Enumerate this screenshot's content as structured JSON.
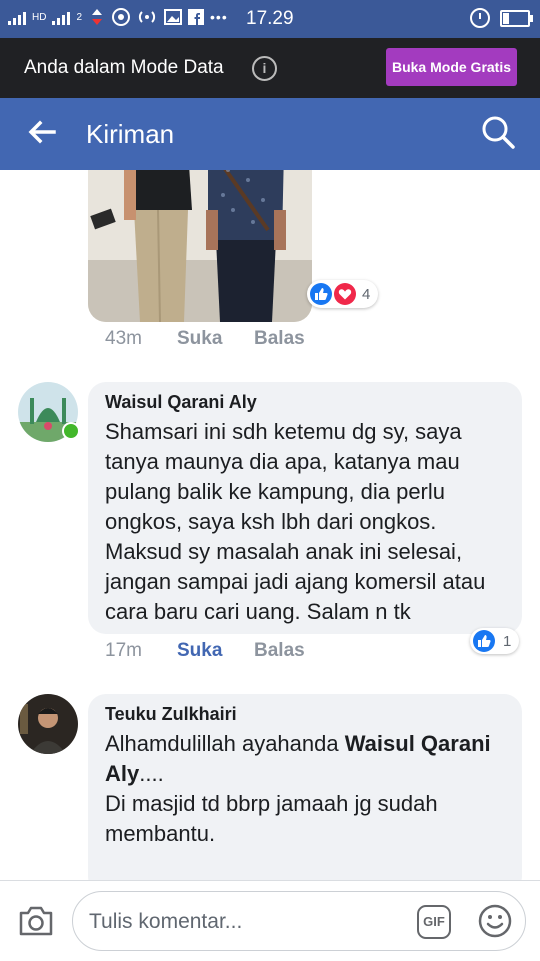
{
  "status_bar": {
    "hd_label": "HD",
    "network_label": "2",
    "time": "17.29",
    "icons": [
      "signal-icon",
      "signal-icon",
      "data-transfer-icon",
      "chrome-icon",
      "hotspot-icon",
      "gallery-icon",
      "facebook-icon",
      "more-icon",
      "alarm-icon",
      "battery-icon"
    ]
  },
  "data_mode": {
    "message": "Anda dalam Mode Data",
    "info_icon": "i",
    "button_label": "Buka Mode Gratis",
    "button_color": "#a33bbf"
  },
  "header": {
    "title": "Kiriman",
    "back_icon": "back-arrow-icon",
    "search_icon": "search-icon",
    "color": "#4267b2"
  },
  "post_photo": {
    "reaction_count": "4",
    "meta": {
      "time": "43m",
      "like": "Suka",
      "reply": "Balas"
    }
  },
  "comments": [
    {
      "author": "Waisul Qarani Aly",
      "text": "Shamsari ini sdh ketemu dg sy, saya tanya maunya dia apa, katanya mau pulang balik ke kampung, dia perlu ongkos, saya ksh lbh dari ongkos. Maksud sy masalah anak ini selesai, jangan sampai jadi ajang  komersil atau cara baru cari uang. Salam n tk",
      "online": true,
      "like_count": "1",
      "meta": {
        "time": "17m",
        "like": "Suka",
        "reply": "Balas",
        "liked": true
      }
    },
    {
      "author": "Teuku Zulkhairi",
      "text_before": "Alhamdulillah ayahanda ",
      "mention": "Waisul Qarani Aly",
      "text_after": "....",
      "text_line2": "Di masjid td bbrp jamaah jg sudah membantu."
    }
  ],
  "comment_bar": {
    "placeholder": "Tulis komentar...",
    "gif_label": "GIF"
  }
}
